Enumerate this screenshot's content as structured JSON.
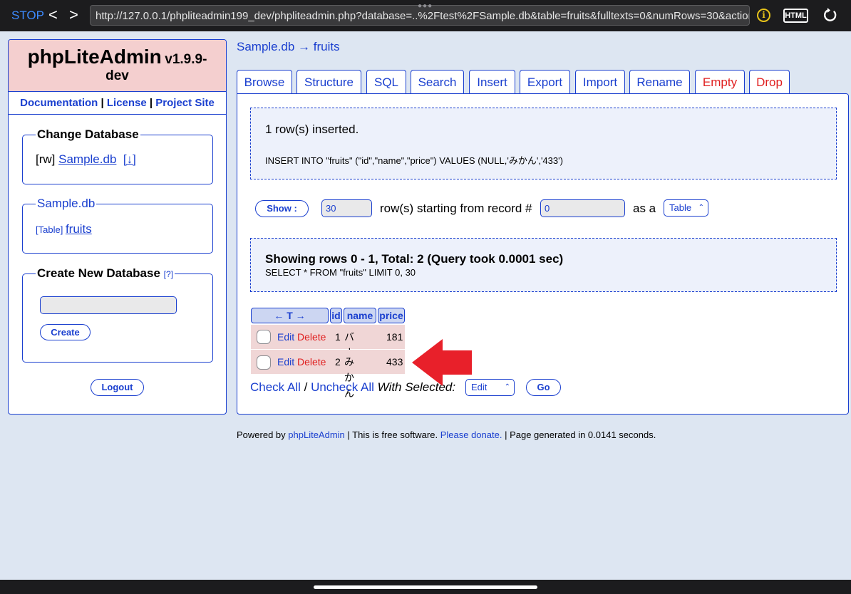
{
  "browser": {
    "stop_label": "STOP",
    "back_icon": "<",
    "forward_icon": ">",
    "url": "http://127.0.0.1/phpliteadmin199_dev/phpliteadmin.php?database=..%2Ftest%2FSample.db&table=fruits&fulltexts=0&numRows=30&action...",
    "info_icon": "i",
    "html_icon": "HTML"
  },
  "sidebar": {
    "app_name": "phpLiteAdmin",
    "version": "v1.9.9-",
    "version_suffix": "dev",
    "links": [
      "Documentation",
      "License",
      "Project Site"
    ],
    "separator": "|",
    "change_db_title": "Change Database",
    "db_mode": "[rw]",
    "db_name": "Sample.db",
    "db_download": "[↓]",
    "current_db_title": "Sample.db",
    "table_tag": "[Table]",
    "table_name": "fruits",
    "create_db_title": "Create New Database",
    "create_db_help": "[?]",
    "create_db_value": "",
    "create_button": "Create",
    "logout_button": "Logout"
  },
  "breadcrumb": {
    "db": "Sample.db",
    "arrow": "→",
    "table": "fruits"
  },
  "tabs": [
    {
      "label": "Browse",
      "danger": false
    },
    {
      "label": "Structure",
      "danger": false
    },
    {
      "label": "SQL",
      "danger": false
    },
    {
      "label": "Search",
      "danger": false
    },
    {
      "label": "Insert",
      "danger": false
    },
    {
      "label": "Export",
      "danger": false
    },
    {
      "label": "Import",
      "danger": false
    },
    {
      "label": "Rename",
      "danger": false
    },
    {
      "label": "Empty",
      "danger": true
    },
    {
      "label": "Drop",
      "danger": true
    }
  ],
  "insert_message": {
    "title": "1 row(s) inserted.",
    "sql": "INSERT INTO \"fruits\" (\"id\",\"name\",\"price\") VALUES (NULL,'みかん','433')"
  },
  "controls": {
    "show_button": "Show :",
    "num_rows": "30",
    "rows_label": "row(s) starting from record #",
    "start_record": "0",
    "as_label": "as a",
    "view_mode": "Table"
  },
  "query_message": {
    "title": "Showing rows 0 - 1, Total: 2 (Query took 0.0001 sec)",
    "sql": "SELECT * FROM \"fruits\" LIMIT 0, 30"
  },
  "table": {
    "columns": [
      "← T →",
      "id",
      "name",
      "price"
    ],
    "edit_label": "Edit",
    "delete_label": "Delete",
    "rows": [
      {
        "id": "1",
        "name": "バナナ",
        "price": "181"
      },
      {
        "id": "2",
        "name": "みかん",
        "price": "433"
      }
    ]
  },
  "actions": {
    "check_all": "Check All",
    "slash": "/",
    "uncheck_all": "Uncheck All",
    "with_selected": "With Selected:",
    "bulk_action": "Edit",
    "go_button": "Go"
  },
  "footer": {
    "powered_by": "Powered by",
    "app_link": "phpLiteAdmin",
    "free_text": "| This is free software.",
    "donate_link": "Please donate.",
    "generated": "| Page generated in 0.0141 seconds."
  },
  "colors": {
    "accent": "#1a3fcf",
    "danger": "#e02020",
    "arrow": "#e8202a"
  }
}
